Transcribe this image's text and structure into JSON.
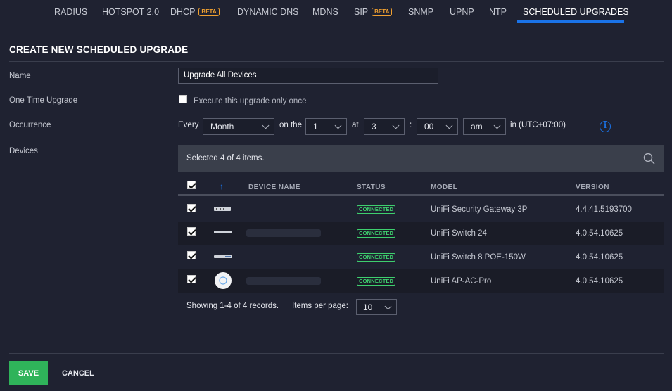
{
  "tabs": [
    {
      "label": "RADIUS"
    },
    {
      "label": "HOTSPOT 2.0"
    },
    {
      "label": "DHCP",
      "badge": "BETA"
    },
    {
      "label": "DYNAMIC DNS"
    },
    {
      "label": "MDNS"
    },
    {
      "label": "SIP",
      "badge": "BETA"
    },
    {
      "label": "SNMP"
    },
    {
      "label": "UPNP"
    },
    {
      "label": "NTP"
    },
    {
      "label": "SCHEDULED UPGRADES",
      "active": true
    }
  ],
  "form": {
    "title": "CREATE NEW SCHEDULED UPGRADE",
    "name_label": "Name",
    "name_value": "Upgrade All Devices",
    "one_time_label": "One Time Upgrade",
    "one_time_checkbox_label": "Execute this upgrade only once",
    "one_time_checked": false,
    "occurrence_label": "Occurrence",
    "every_label": "Every",
    "every_value": "Month",
    "on_the_label": "on the",
    "day_value": "1",
    "at_label": "at",
    "hour_value": "3",
    "colon": ":",
    "minute_value": "00",
    "ampm_value": "am",
    "timezone": "in (UTC+07:00)",
    "devices_label": "Devices"
  },
  "devices": {
    "selection_summary": "Selected 4 of 4 items.",
    "columns": {
      "sort_arrow": "↑",
      "name": "DEVICE NAME",
      "status": "STATUS",
      "model": "MODEL",
      "version": "VERSION"
    },
    "rows": [
      {
        "status": "CONNECTED",
        "model": "UniFi Security Gateway 3P",
        "version": "4.4.41.5193700",
        "checked": true
      },
      {
        "status": "CONNECTED",
        "model": "UniFi Switch 24",
        "version": "4.0.54.10625",
        "checked": true
      },
      {
        "status": "CONNECTED",
        "model": "UniFi Switch 8 POE-150W",
        "version": "4.0.54.10625",
        "checked": true
      },
      {
        "status": "CONNECTED",
        "model": "UniFi AP-AC-Pro",
        "version": "4.0.54.10625",
        "checked": true
      }
    ],
    "pagination_text": "Showing 1-4 of 4 records.",
    "items_per_page_label": "Items per page:",
    "items_per_page_value": "10"
  },
  "actions": {
    "save_label": "SAVE",
    "cancel_label": "CANCEL"
  },
  "colors": {
    "accent": "#1a73e8",
    "success": "#2fb35a",
    "beta": "#f0a030",
    "background": "#1f2231"
  }
}
